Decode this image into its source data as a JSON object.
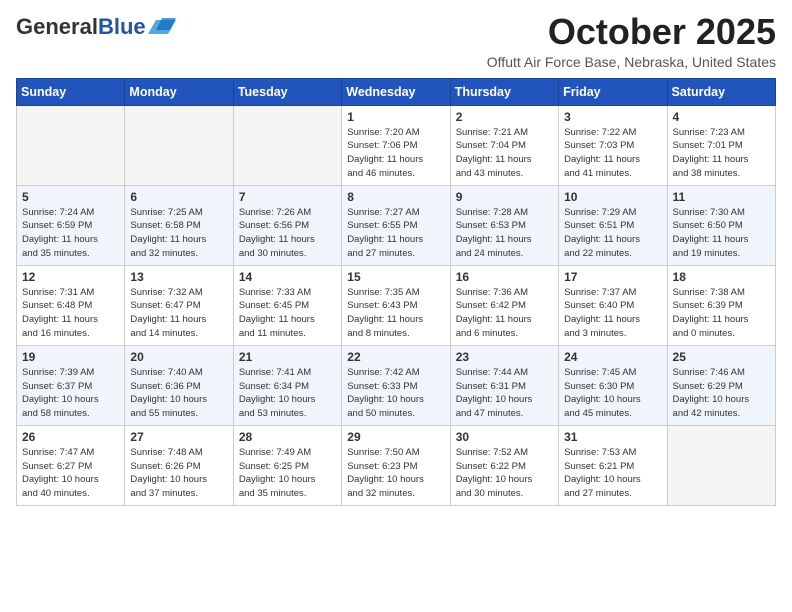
{
  "header": {
    "logo_general": "General",
    "logo_blue": "Blue",
    "month_title": "October 2025",
    "location": "Offutt Air Force Base, Nebraska, United States"
  },
  "days_of_week": [
    "Sunday",
    "Monday",
    "Tuesday",
    "Wednesday",
    "Thursday",
    "Friday",
    "Saturday"
  ],
  "weeks": [
    [
      {
        "day": "",
        "info": ""
      },
      {
        "day": "",
        "info": ""
      },
      {
        "day": "",
        "info": ""
      },
      {
        "day": "1",
        "info": "Sunrise: 7:20 AM\nSunset: 7:06 PM\nDaylight: 11 hours\nand 46 minutes."
      },
      {
        "day": "2",
        "info": "Sunrise: 7:21 AM\nSunset: 7:04 PM\nDaylight: 11 hours\nand 43 minutes."
      },
      {
        "day": "3",
        "info": "Sunrise: 7:22 AM\nSunset: 7:03 PM\nDaylight: 11 hours\nand 41 minutes."
      },
      {
        "day": "4",
        "info": "Sunrise: 7:23 AM\nSunset: 7:01 PM\nDaylight: 11 hours\nand 38 minutes."
      }
    ],
    [
      {
        "day": "5",
        "info": "Sunrise: 7:24 AM\nSunset: 6:59 PM\nDaylight: 11 hours\nand 35 minutes."
      },
      {
        "day": "6",
        "info": "Sunrise: 7:25 AM\nSunset: 6:58 PM\nDaylight: 11 hours\nand 32 minutes."
      },
      {
        "day": "7",
        "info": "Sunrise: 7:26 AM\nSunset: 6:56 PM\nDaylight: 11 hours\nand 30 minutes."
      },
      {
        "day": "8",
        "info": "Sunrise: 7:27 AM\nSunset: 6:55 PM\nDaylight: 11 hours\nand 27 minutes."
      },
      {
        "day": "9",
        "info": "Sunrise: 7:28 AM\nSunset: 6:53 PM\nDaylight: 11 hours\nand 24 minutes."
      },
      {
        "day": "10",
        "info": "Sunrise: 7:29 AM\nSunset: 6:51 PM\nDaylight: 11 hours\nand 22 minutes."
      },
      {
        "day": "11",
        "info": "Sunrise: 7:30 AM\nSunset: 6:50 PM\nDaylight: 11 hours\nand 19 minutes."
      }
    ],
    [
      {
        "day": "12",
        "info": "Sunrise: 7:31 AM\nSunset: 6:48 PM\nDaylight: 11 hours\nand 16 minutes."
      },
      {
        "day": "13",
        "info": "Sunrise: 7:32 AM\nSunset: 6:47 PM\nDaylight: 11 hours\nand 14 minutes."
      },
      {
        "day": "14",
        "info": "Sunrise: 7:33 AM\nSunset: 6:45 PM\nDaylight: 11 hours\nand 11 minutes."
      },
      {
        "day": "15",
        "info": "Sunrise: 7:35 AM\nSunset: 6:43 PM\nDaylight: 11 hours\nand 8 minutes."
      },
      {
        "day": "16",
        "info": "Sunrise: 7:36 AM\nSunset: 6:42 PM\nDaylight: 11 hours\nand 6 minutes."
      },
      {
        "day": "17",
        "info": "Sunrise: 7:37 AM\nSunset: 6:40 PM\nDaylight: 11 hours\nand 3 minutes."
      },
      {
        "day": "18",
        "info": "Sunrise: 7:38 AM\nSunset: 6:39 PM\nDaylight: 11 hours\nand 0 minutes."
      }
    ],
    [
      {
        "day": "19",
        "info": "Sunrise: 7:39 AM\nSunset: 6:37 PM\nDaylight: 10 hours\nand 58 minutes."
      },
      {
        "day": "20",
        "info": "Sunrise: 7:40 AM\nSunset: 6:36 PM\nDaylight: 10 hours\nand 55 minutes."
      },
      {
        "day": "21",
        "info": "Sunrise: 7:41 AM\nSunset: 6:34 PM\nDaylight: 10 hours\nand 53 minutes."
      },
      {
        "day": "22",
        "info": "Sunrise: 7:42 AM\nSunset: 6:33 PM\nDaylight: 10 hours\nand 50 minutes."
      },
      {
        "day": "23",
        "info": "Sunrise: 7:44 AM\nSunset: 6:31 PM\nDaylight: 10 hours\nand 47 minutes."
      },
      {
        "day": "24",
        "info": "Sunrise: 7:45 AM\nSunset: 6:30 PM\nDaylight: 10 hours\nand 45 minutes."
      },
      {
        "day": "25",
        "info": "Sunrise: 7:46 AM\nSunset: 6:29 PM\nDaylight: 10 hours\nand 42 minutes."
      }
    ],
    [
      {
        "day": "26",
        "info": "Sunrise: 7:47 AM\nSunset: 6:27 PM\nDaylight: 10 hours\nand 40 minutes."
      },
      {
        "day": "27",
        "info": "Sunrise: 7:48 AM\nSunset: 6:26 PM\nDaylight: 10 hours\nand 37 minutes."
      },
      {
        "day": "28",
        "info": "Sunrise: 7:49 AM\nSunset: 6:25 PM\nDaylight: 10 hours\nand 35 minutes."
      },
      {
        "day": "29",
        "info": "Sunrise: 7:50 AM\nSunset: 6:23 PM\nDaylight: 10 hours\nand 32 minutes."
      },
      {
        "day": "30",
        "info": "Sunrise: 7:52 AM\nSunset: 6:22 PM\nDaylight: 10 hours\nand 30 minutes."
      },
      {
        "day": "31",
        "info": "Sunrise: 7:53 AM\nSunset: 6:21 PM\nDaylight: 10 hours\nand 27 minutes."
      },
      {
        "day": "",
        "info": ""
      }
    ]
  ]
}
